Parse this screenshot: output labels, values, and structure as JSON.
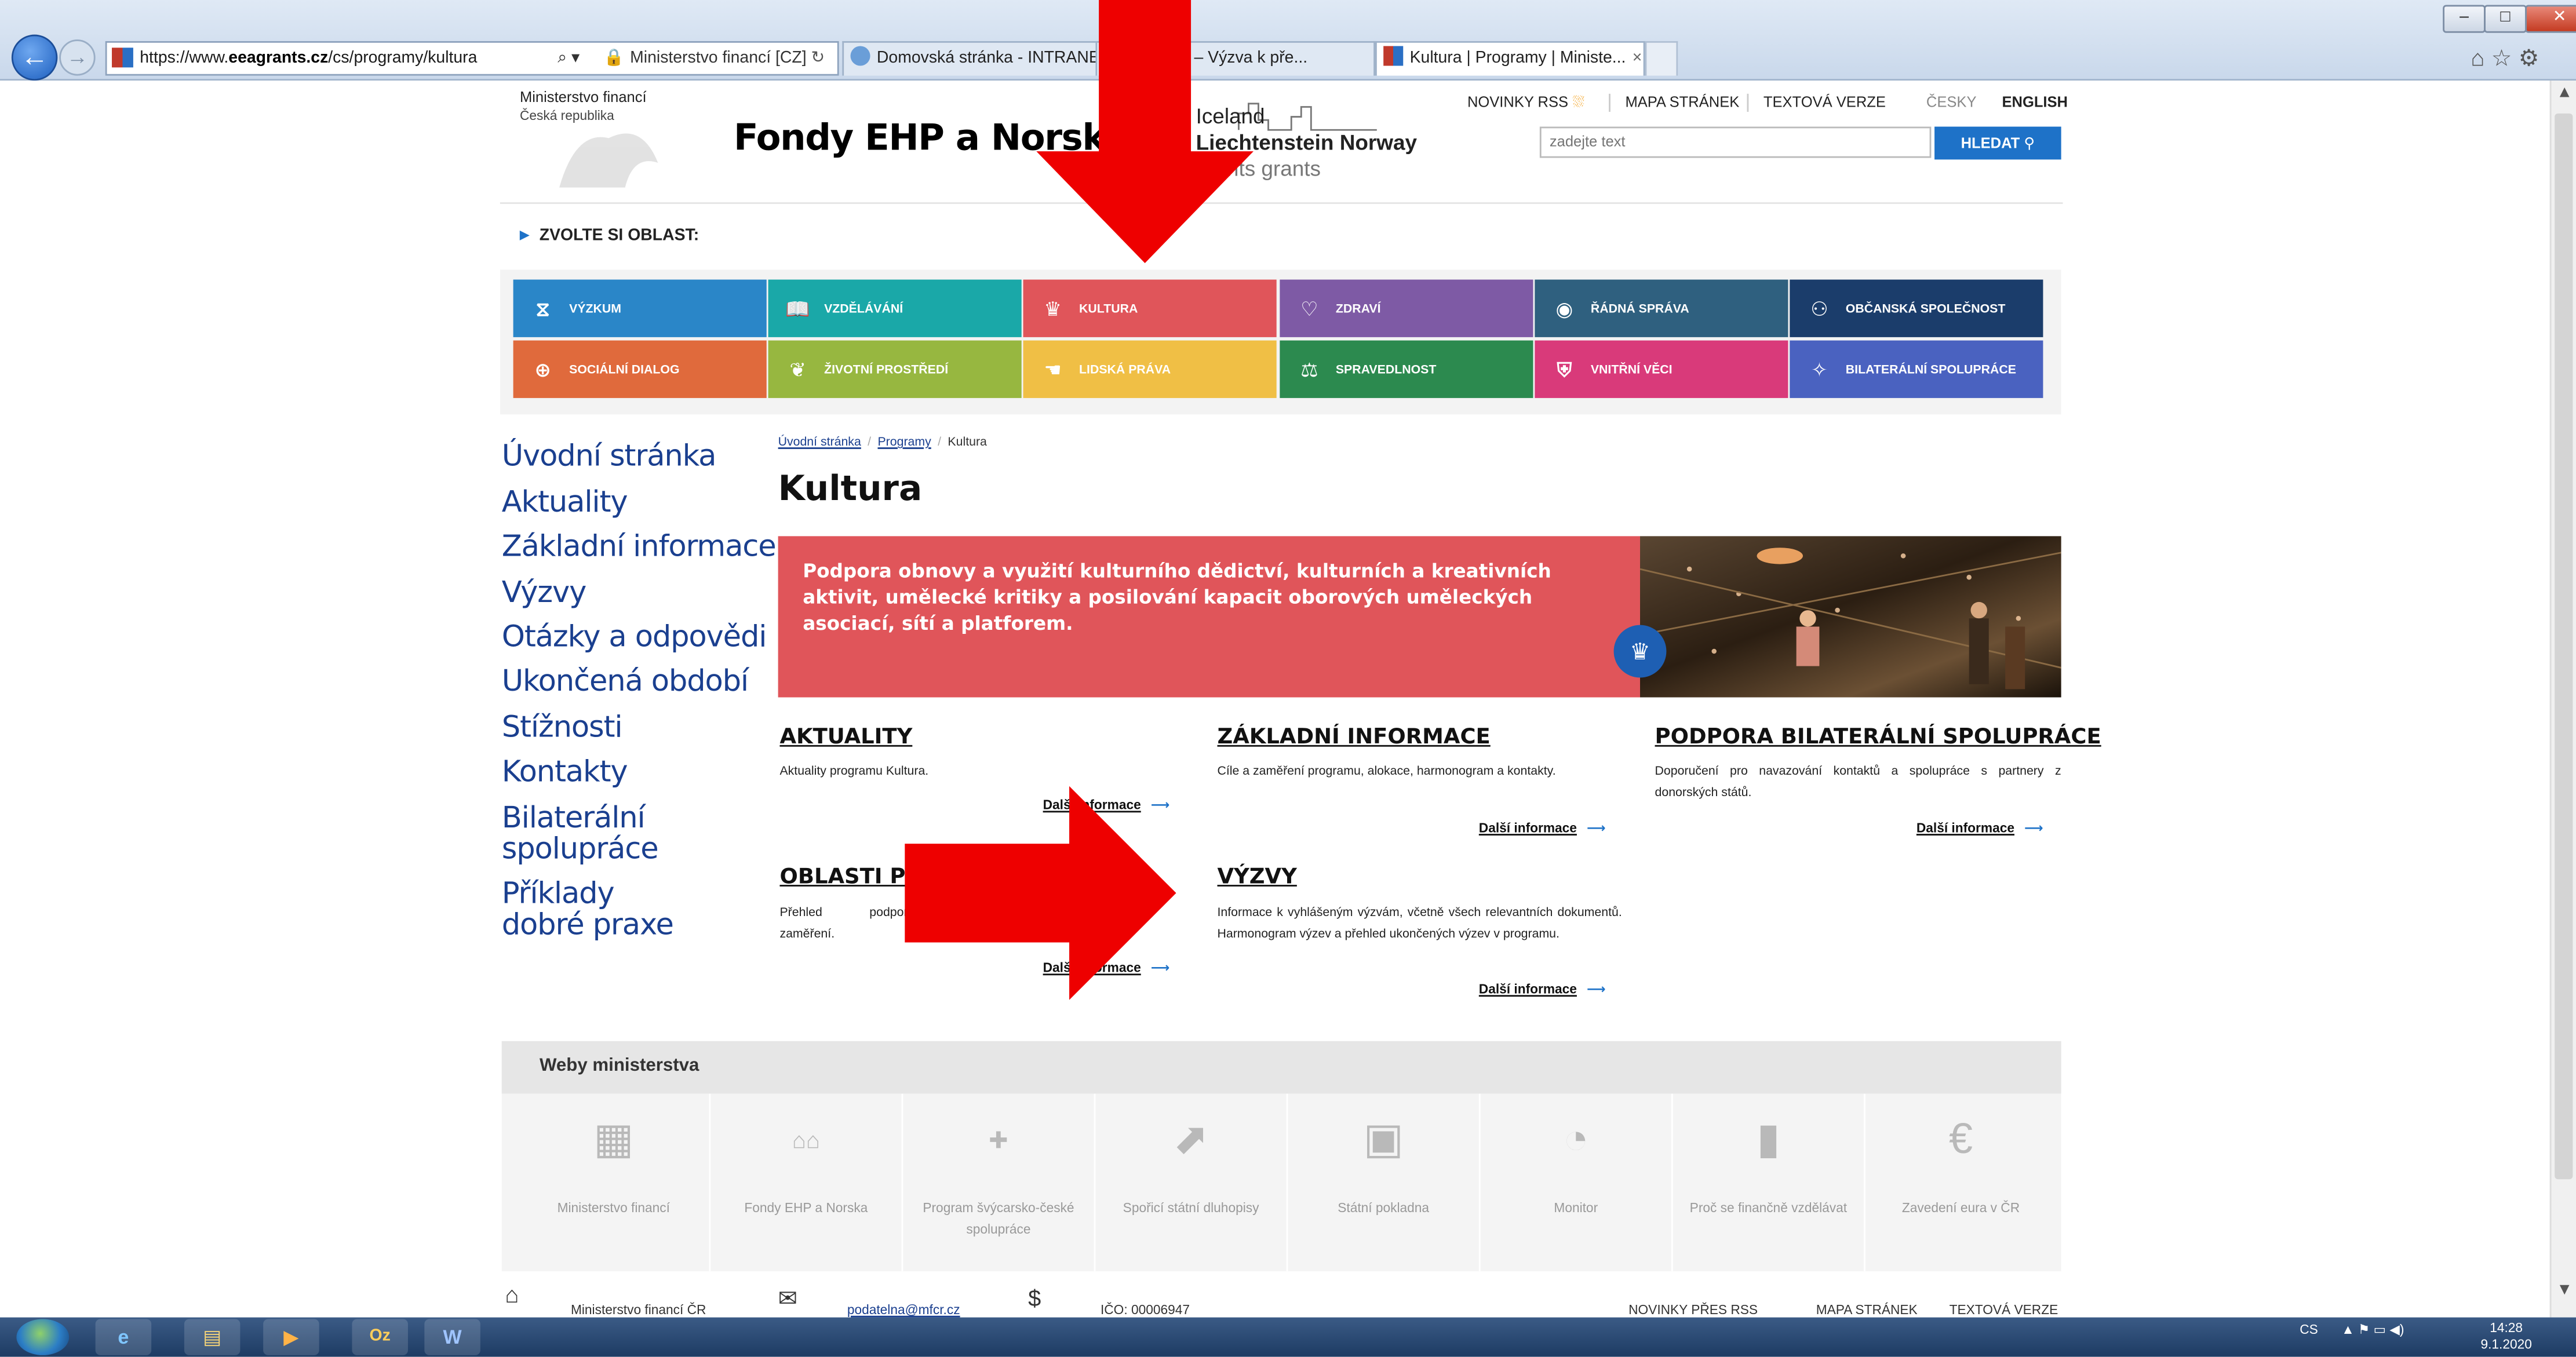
{
  "browser": {
    "url_prefix": "https://www.",
    "url_domain": "eeagrants.cz",
    "url_path": "/cs/programy/kultura",
    "search_ctrl": "⌕ ▾",
    "site_id": "Ministerstvo financí [CZ]",
    "tabs": [
      {
        "label": "Domovská stránka - INTRANE..."
      },
      {
        "label": "é umění – Výzva k pře..."
      },
      {
        "label": "Kultura | Programy | Ministe..."
      }
    ],
    "tab_close": "×",
    "win_min": "–",
    "win_max": "□",
    "win_close": "✕",
    "toolbar_icons": "⌂☆⚙"
  },
  "header": {
    "ministry": "Ministerstvo financí",
    "ministry_sub": "Česká republika",
    "site_title": "Fondy EHP a Norska",
    "grants_line1": "Iceland",
    "grants_line2": "Liechtenstein  Norway",
    "grants_line3": "grants  grants",
    "topnav": {
      "rss": "NOVINKY RSS",
      "map": "MAPA STRÁNEK",
      "text": "TEXTOVÁ VERZE",
      "cz": "ČESKY",
      "en": "ENGLISH"
    },
    "search_placeholder": "zadejte text",
    "search_button": "HLEDAT ⚲"
  },
  "zvolte": "ZVOLTE SI OBLAST:",
  "tiles": [
    {
      "label": "VÝZKUM",
      "icon": "dna-icon",
      "glyph": "⧖",
      "color": "#2a86c8"
    },
    {
      "label": "VZDĚLÁVÁNÍ",
      "icon": "book-icon",
      "glyph": "📖",
      "color": "#1aa8a8"
    },
    {
      "label": "KULTURA",
      "icon": "crown-icon",
      "glyph": "♛",
      "color": "#e0555a"
    },
    {
      "label": "ZDRAVÍ",
      "icon": "heart-icon",
      "glyph": "♡",
      "color": "#7e5aa5"
    },
    {
      "label": "ŘÁDNÁ SPRÁVA",
      "icon": "eye-icon",
      "glyph": "◉",
      "color": "#2f607f"
    },
    {
      "label": "OBČANSKÁ SPOLEČNOST",
      "icon": "people-icon",
      "glyph": "⚇",
      "color": "#1b3d6b"
    },
    {
      "label": "SOCIÁLNÍ DIALOG",
      "icon": "globe-icon",
      "glyph": "⊕",
      "color": "#e06a3c"
    },
    {
      "label": "ŽIVOTNÍ PROSTŘEDÍ",
      "icon": "leaf-icon",
      "glyph": "❦",
      "color": "#97b740"
    },
    {
      "label": "LIDSKÁ PRÁVA",
      "icon": "handshake-icon",
      "glyph": "☚",
      "color": "#f0bf45"
    },
    {
      "label": "SPRAVEDLNOST",
      "icon": "justice-icon",
      "glyph": "⚖",
      "color": "#2c8a4f"
    },
    {
      "label": "VNITŘNÍ VĚCI",
      "icon": "shield-icon",
      "glyph": "⛨",
      "color": "#d93a7a"
    },
    {
      "label": "BILATERÁLNÍ SPOLUPRÁCE",
      "icon": "handshake-blue-icon",
      "glyph": "✧",
      "color": "#4a62c0"
    }
  ],
  "leftnav": [
    "Úvodní stránka",
    "Aktuality",
    "Základní informace",
    "Výzvy",
    "Otázky a odpovědi",
    "Ukončená období",
    "Stížnosti",
    "Kontakty",
    "Bilaterální spolupráce",
    "Příklady dobré praxe"
  ],
  "breadcrumb": {
    "home": "Úvodní stránka",
    "programs": "Programy",
    "current": "Kultura",
    "sep": "/"
  },
  "page_title": "Kultura",
  "hero_text": "Podpora obnovy a využití kulturního dědictví, kulturních a kreativních aktivit, umělecké kritiky a posilování kapacit oborových uměleckých asociací, sítí a platforem.",
  "hero_badge": "♛",
  "boxes": {
    "aktuality": {
      "title": "AKTUALITY",
      "text": "Aktuality programu Kultura.",
      "more": "Další informace"
    },
    "zakladni": {
      "title": "ZÁKLADNÍ INFORMACE",
      "text": "Cíle a zaměření programu, alokace, harmonogram a kontakty.",
      "more": "Další informace"
    },
    "bilateral": {
      "title": "PODPORA BILATERÁLNÍ SPOLUPRÁCE",
      "text": "Doporučení pro navazování kontaktů a spolupráce s partnery z donorských států.",
      "more": "Další informace"
    },
    "oblasti": {
      "title": "OBLASTI PO",
      "text": "Přehled podporova zaměření.",
      "more": "Další informace"
    },
    "vyzvy": {
      "title": "VÝZVY",
      "text": "Informace k vyhlášeným výzvám, včetně všech relevantních dokumentů. Harmonogram výzev a přehled ukončených výzev v programu.",
      "more": "Další informace"
    }
  },
  "more_arrow": "⟶",
  "weby": {
    "title": "Weby ministerstva",
    "items": [
      {
        "label": "Ministerstvo financí",
        "icon": "coat-of-arms-icon",
        "glyph": "▦"
      },
      {
        "label": "Fondy EHP a Norska",
        "icon": "grants-logo-icon",
        "glyph": "⌂⌂"
      },
      {
        "label": "Program švýcarsko-české spolupráce",
        "icon": "swiss-logo-icon",
        "glyph": "✚"
      },
      {
        "label": "Spořicí státní dluhopisy",
        "icon": "chart-arrow-icon",
        "glyph": "⬈"
      },
      {
        "label": "Státní pokladna",
        "icon": "safe-icon",
        "glyph": "▣"
      },
      {
        "label": "Monitor",
        "icon": "pie-icon",
        "glyph": "◔"
      },
      {
        "label": "Proč se finančně vzdělávat",
        "icon": "book-grey-icon",
        "glyph": "▮"
      },
      {
        "label": "Zavedení eura v ČR",
        "icon": "euro-icon",
        "glyph": "€"
      }
    ]
  },
  "footer": {
    "ministry": "Ministerstvo financí ČR",
    "email": "podatelna@mfcr.cz",
    "ico": "IČO: 00006947",
    "rss": "NOVINKY PŘES RSS",
    "map": "MAPA STRÁNEK",
    "text": "TEXTOVÁ VERZE"
  },
  "taskbar": {
    "apps": [
      "e",
      "▤",
      "▶",
      "Oz",
      "W"
    ],
    "lang": "CS",
    "tray": "▲ ⚑ ▭ ◀)",
    "time": "14:28",
    "date": "9.1.2020"
  }
}
